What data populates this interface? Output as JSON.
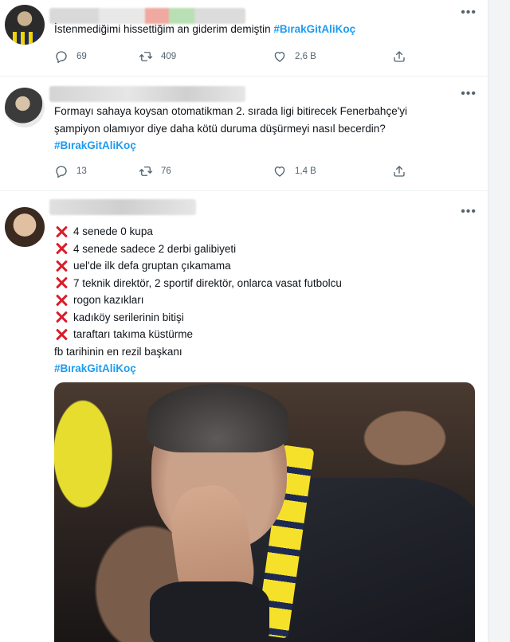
{
  "tweets": [
    {
      "text": "İstenmediğimi hissettiğim an giderim demiştin",
      "hashtag": "#BırakGitAliKoç",
      "replies": "69",
      "retweets": "409",
      "likes": "2,6 B"
    },
    {
      "text_line1": "Formayı sahaya koysan otomatikman 2. sırada ligi bitirecek Fenerbahçe'yi",
      "text_line2": "şampiyon olamıyor diye daha kötü duruma düşürmeyi nasıl becerdin?",
      "hashtag": "#BırakGitAliKoç",
      "replies": "13",
      "retweets": "76",
      "likes": "1,4 B"
    },
    {
      "list": [
        "4 senede 0 kupa",
        "4 senede sadece 2 derbi galibiyeti",
        "uel'de ilk defa gruptan çıkamama",
        "7 teknik direktör, 2 sportif direktör, onlarca vasat futbolcu",
        "rogon kazıkları",
        "kadıköy serilerinin bitişi",
        "taraftarı takıma küstürme"
      ],
      "closing": "fb tarihinin en rezil başkanı",
      "hashtag": "#BırakGitAliKoç"
    }
  ],
  "icons": {
    "reply": "reply-icon",
    "retweet": "retweet-icon",
    "like": "heart-icon",
    "share": "share-icon",
    "more": "more-icon",
    "cross": "cross-mark-icon"
  },
  "colors": {
    "hashtag": "#1d9bf0",
    "cross": "#d81e2a",
    "muted": "#536471"
  }
}
